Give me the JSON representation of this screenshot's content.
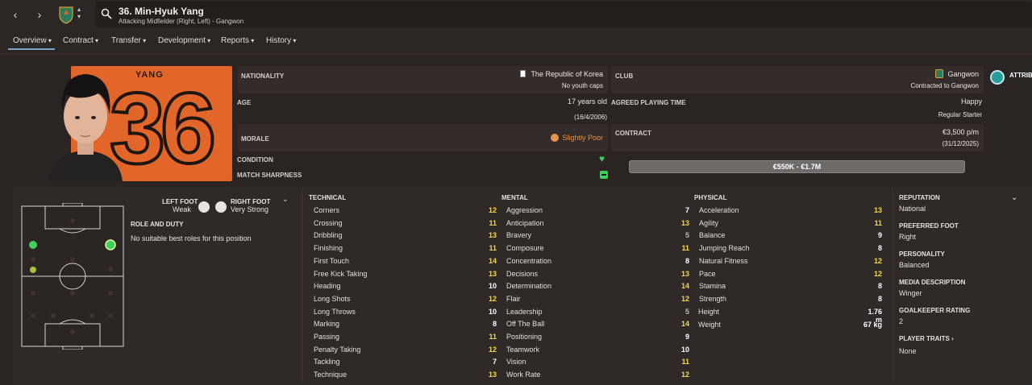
{
  "header": {
    "title": "36. Min-Hyuk Yang",
    "subtitle": "Attacking Midfielder (Right, Left) - Gangwon",
    "club_badge_text": "GANGWON"
  },
  "tabs": [
    "Overview",
    "Contract",
    "Transfer",
    "Development",
    "Reports",
    "History"
  ],
  "jersey": {
    "name": "YANG",
    "number": "36"
  },
  "details": {
    "nationality_label": "NATIONALITY",
    "nationality": "The Republic of Korea",
    "youth_caps": "No youth caps",
    "age_label": "AGE",
    "age": "17 years old",
    "dob": "(16/4/2006)",
    "morale_label": "MORALE",
    "morale": "Slightly Poor",
    "condition_label": "CONDITION",
    "sharpness_label": "MATCH SHARPNESS",
    "club_label": "CLUB",
    "club": "Gangwon",
    "contracted": "Contracted to Gangwon",
    "playing_time_label": "AGREED PLAYING TIME",
    "playing_time_status": "Happy",
    "playing_time": "Regular Starter",
    "contract_label": "CONTRACT",
    "wage": "€3,500 p/m",
    "contract_end": "(31/12/2025)",
    "value_range": "€550K - €1.7M",
    "attributes_cut": "ATTRIB"
  },
  "feet": {
    "left_label": "LEFT FOOT",
    "left": "Weak",
    "right_label": "RIGHT FOOT",
    "right": "Very Strong"
  },
  "role": {
    "label": "ROLE AND DUTY",
    "text": "No suitable best roles for this position"
  },
  "technical": {
    "header": "TECHNICAL",
    "items": [
      {
        "name": "Corners",
        "value": "12"
      },
      {
        "name": "Crossing",
        "value": "11"
      },
      {
        "name": "Dribbling",
        "value": "13"
      },
      {
        "name": "Finishing",
        "value": "11"
      },
      {
        "name": "First Touch",
        "value": "14"
      },
      {
        "name": "Free Kick Taking",
        "value": "13"
      },
      {
        "name": "Heading",
        "value": "10"
      },
      {
        "name": "Long Shots",
        "value": "12"
      },
      {
        "name": "Long Throws",
        "value": "10"
      },
      {
        "name": "Marking",
        "value": "8"
      },
      {
        "name": "Passing",
        "value": "11"
      },
      {
        "name": "Penalty Taking",
        "value": "12"
      },
      {
        "name": "Tackling",
        "value": "7"
      },
      {
        "name": "Technique",
        "value": "13"
      }
    ]
  },
  "mental": {
    "header": "MENTAL",
    "items": [
      {
        "name": "Aggression",
        "value": "7"
      },
      {
        "name": "Anticipation",
        "value": "13"
      },
      {
        "name": "Bravery",
        "value": "5"
      },
      {
        "name": "Composure",
        "value": "11"
      },
      {
        "name": "Concentration",
        "value": "8"
      },
      {
        "name": "Decisions",
        "value": "13"
      },
      {
        "name": "Determination",
        "value": "14"
      },
      {
        "name": "Flair",
        "value": "12"
      },
      {
        "name": "Leadership",
        "value": "5"
      },
      {
        "name": "Off The Ball",
        "value": "14"
      },
      {
        "name": "Positioning",
        "value": "9"
      },
      {
        "name": "Teamwork",
        "value": "10"
      },
      {
        "name": "Vision",
        "value": "11"
      },
      {
        "name": "Work Rate",
        "value": "12"
      }
    ]
  },
  "physical": {
    "header": "PHYSICAL",
    "items": [
      {
        "name": "Acceleration",
        "value": "13"
      },
      {
        "name": "Agility",
        "value": "11"
      },
      {
        "name": "Balance",
        "value": "9"
      },
      {
        "name": "Jumping Reach",
        "value": "8"
      },
      {
        "name": "Natural Fitness",
        "value": "12"
      },
      {
        "name": "Pace",
        "value": "12"
      },
      {
        "name": "Stamina",
        "value": "8"
      },
      {
        "name": "Strength",
        "value": "8"
      }
    ],
    "height_label": "Height",
    "height": "1.76 m",
    "weight_label": "Weight",
    "weight": "67 kg"
  },
  "info": {
    "reputation_label": "REPUTATION",
    "reputation": "National",
    "preferred_foot_label": "PREFERRED FOOT",
    "preferred_foot": "Right",
    "personality_label": "PERSONALITY",
    "personality": "Balanced",
    "media_label": "MEDIA DESCRIPTION",
    "media": "Winger",
    "gk_label": "GOALKEEPER RATING",
    "gk": "2",
    "traits_label": "PLAYER TRAITS",
    "traits": "None"
  },
  "colors": {
    "jersey": "#e2662a",
    "attr_white": "#ffffff",
    "attr_yellow": "#f2d94a",
    "attr_low": "#bdb8b3",
    "green": "#3ecf5c",
    "morale": "#e8934a",
    "tab_accent": "#7fa7c4"
  }
}
